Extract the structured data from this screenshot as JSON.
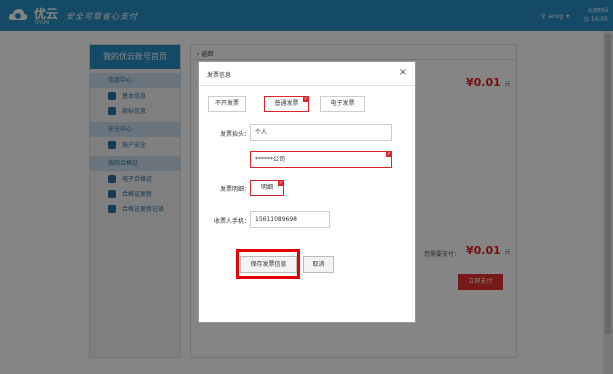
{
  "header": {
    "logo_text": "优云",
    "logo_sub": "UYUN",
    "slogan": "安全可靠省心支付",
    "user": "anxg",
    "time_label": "北京时间",
    "time": "14:05"
  },
  "sidebar": {
    "title": "我的优云账号首页",
    "groups": [
      {
        "label": "信息中心",
        "items": [
          "基本信息",
          "商标信息"
        ]
      },
      {
        "label": "安全中心",
        "items": [
          "账户安全"
        ]
      },
      {
        "label": "我的合格证",
        "items": [
          "电子合格证",
          "合格证更新",
          "合格证更新记录"
        ]
      }
    ]
  },
  "main": {
    "back": "返回",
    "price_top": "¥0.01",
    "currency": "元",
    "pay_label": "您需要支付：",
    "price_bottom": "¥0.01",
    "pay_button": "立即支付"
  },
  "modal": {
    "title": "发票信息",
    "close": "×",
    "options": [
      "不开发票",
      "普通发票",
      "电子发票"
    ],
    "selected_option": "普通发票",
    "header_label": "发票抬头：",
    "header_value": "个人",
    "company_value": "******公司",
    "detail_label": "发票明细：",
    "detail_value": "明细",
    "phone_label": "收票人手机：",
    "phone_value": "15611089698",
    "save_button": "保存发票信息",
    "cancel_button": "取消"
  },
  "colors": {
    "brand_blue": "#2a8fc3",
    "accent_red": "#d9262c"
  }
}
